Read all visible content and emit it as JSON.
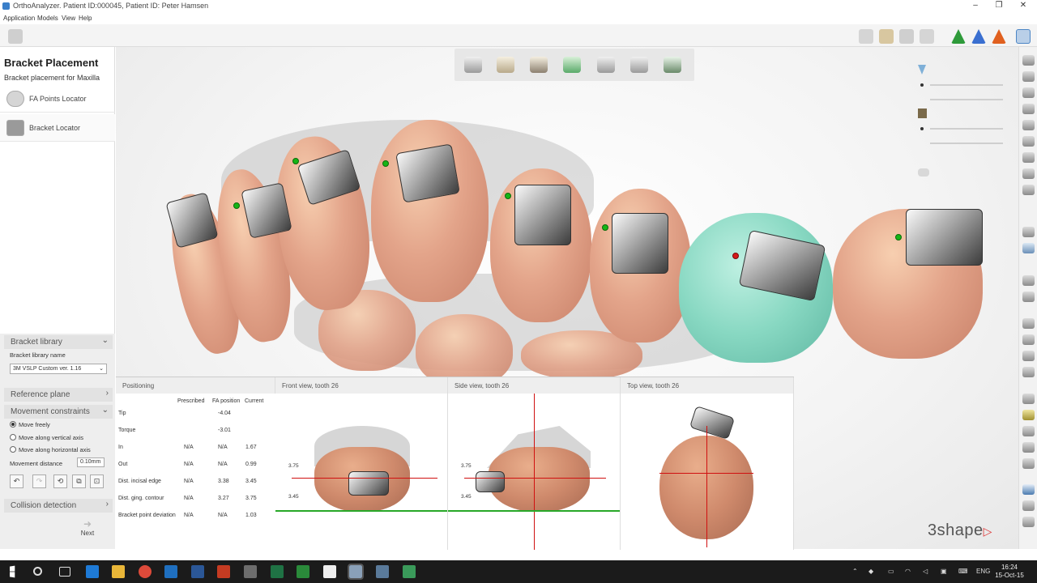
{
  "window": {
    "title": "OrthoAnalyzer. Patient ID:000045, Patient ID: Peter Hamsen",
    "minimize": "–",
    "restore": "❐",
    "close": "✕"
  },
  "menu": [
    "Application",
    "Models",
    "View",
    "Help"
  ],
  "sidebar": {
    "title": "Bracket Placement",
    "subtitle": "Bracket placement for Maxilla",
    "steps": [
      {
        "label": "FA Points Locator",
        "icon": "fa-points-icon"
      },
      {
        "label": "Bracket Locator",
        "icon": "bracket-icon"
      }
    ],
    "bracket_library": {
      "header": "Bracket library",
      "name_label": "Bracket library name",
      "selected": "3M VSLP Custom ver. 1.16"
    },
    "reference_plane": "Reference plane",
    "movement": {
      "header": "Movement constraints",
      "options": [
        "Move freely",
        "Move along vertical axis",
        "Move along horizontal axis"
      ],
      "selected_index": 0,
      "distance_label": "Movement distance",
      "distance_value": "0.10mm"
    },
    "collision": "Collision detection",
    "next": "Next"
  },
  "positioning": {
    "header": "Positioning",
    "columns": [
      "Prescribed",
      "FA position",
      "Current"
    ],
    "rows": [
      {
        "label": "Tip",
        "prescribed": "",
        "fa": "-4.04",
        "current": ""
      },
      {
        "label": "Torque",
        "prescribed": "",
        "fa": "-3.01",
        "current": ""
      },
      {
        "label": "In",
        "prescribed": "N/A",
        "fa": "N/A",
        "current": "1.67"
      },
      {
        "label": "Out",
        "prescribed": "N/A",
        "fa": "N/A",
        "current": "0.99"
      },
      {
        "label": "Dist. incisal edge",
        "prescribed": "N/A",
        "fa": "3.38",
        "current": "3.45"
      },
      {
        "label": "Dist. ging. contour",
        "prescribed": "N/A",
        "fa": "3.27",
        "current": "3.75"
      },
      {
        "label": "Bracket point deviation",
        "prescribed": "N/A",
        "fa": "N/A",
        "current": "1.03"
      }
    ]
  },
  "views": {
    "front": {
      "title": "Front view, tooth 26",
      "dim_top": "3.75",
      "dim_bottom": "3.45"
    },
    "side": {
      "title": "Side view, tooth 26",
      "dim_top": "3.75",
      "dim_bottom": "3.45"
    },
    "top": {
      "title": "Top view, tooth 26"
    }
  },
  "logo": {
    "text": "3shape",
    "mark": "▷"
  },
  "taskbar": {
    "lang": "ENG",
    "time": "16:24",
    "date": "15-Oct-15"
  },
  "colors": {
    "accent_green": "#28a828",
    "selected_tooth": "#7fd8c0",
    "guide_red": "#d01010"
  }
}
